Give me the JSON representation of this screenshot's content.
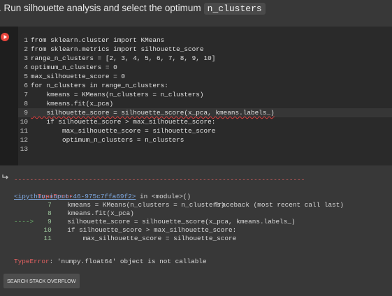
{
  "heading": {
    "text": ". Run silhouette analysis and select the optimum",
    "code": "n_clusters"
  },
  "code_cell": {
    "lines": [
      {
        "n": "1",
        "text": "from sklearn.cluster import KMeans"
      },
      {
        "n": "2",
        "text": "from sklearn.metrics import silhouette_score"
      },
      {
        "n": "3",
        "text": "range_n_clusters = [2, 3, 4, 5, 6, 7, 8, 9, 10]"
      },
      {
        "n": "4",
        "text": "optimum_n_clusters = 0"
      },
      {
        "n": "5",
        "text": "max_silhouette_score = 0"
      },
      {
        "n": "6",
        "text": "for n_clusters in range_n_clusters:"
      },
      {
        "n": "7",
        "text": "    kmeans = KMeans(n_clusters = n_clusters)"
      },
      {
        "n": "8",
        "text": "    kmeans.fit(x_pca)"
      },
      {
        "n": "9",
        "text": "    silhouette_score = silhouette_score(x_pca, kmeans.labels_)"
      },
      {
        "n": "10",
        "text": "    if silhouette_score > max_silhouette_score:"
      },
      {
        "n": "11",
        "text": "        max_silhouette_score = silhouette_score"
      },
      {
        "n": "12",
        "text": "        optimum_n_clusters = n_clusters"
      },
      {
        "n": "13",
        "text": ""
      }
    ]
  },
  "output": {
    "dashes": "--------------------------------------------------------------------------",
    "error_name": "TypeError",
    "traceback_label": "Traceback (most recent call last)",
    "link": "<ipython-input-46-975c7ffa69f2>",
    "in_module": " in <module>()",
    "trace": [
      {
        "marker": "     ",
        "n": "7",
        "text": "    kmeans = KMeans(n_clusters = n_clusters)"
      },
      {
        "marker": "     ",
        "n": "8",
        "text": "    kmeans.fit(x_pca)"
      },
      {
        "marker": "---->",
        "n": "9",
        "text": "    silhouette_score = silhouette_score(x_pca, kmeans.labels_)"
      },
      {
        "marker": "     ",
        "n": "10",
        "text": "    if silhouette_score > max_silhouette_score:"
      },
      {
        "marker": "     ",
        "n": "11",
        "text": "        max_silhouette_score = silhouette_score"
      }
    ],
    "error_msg_name": "TypeError",
    "error_msg": ": 'numpy.float64' object is not callable",
    "so_button": "SEARCH STACK OVERFLOW"
  },
  "colors": {
    "run_button": "#e8453c",
    "error": "#e06060",
    "link": "#7ea8e0"
  },
  "icons": {
    "run": "play-icon",
    "output": "output-arrow-icon"
  }
}
